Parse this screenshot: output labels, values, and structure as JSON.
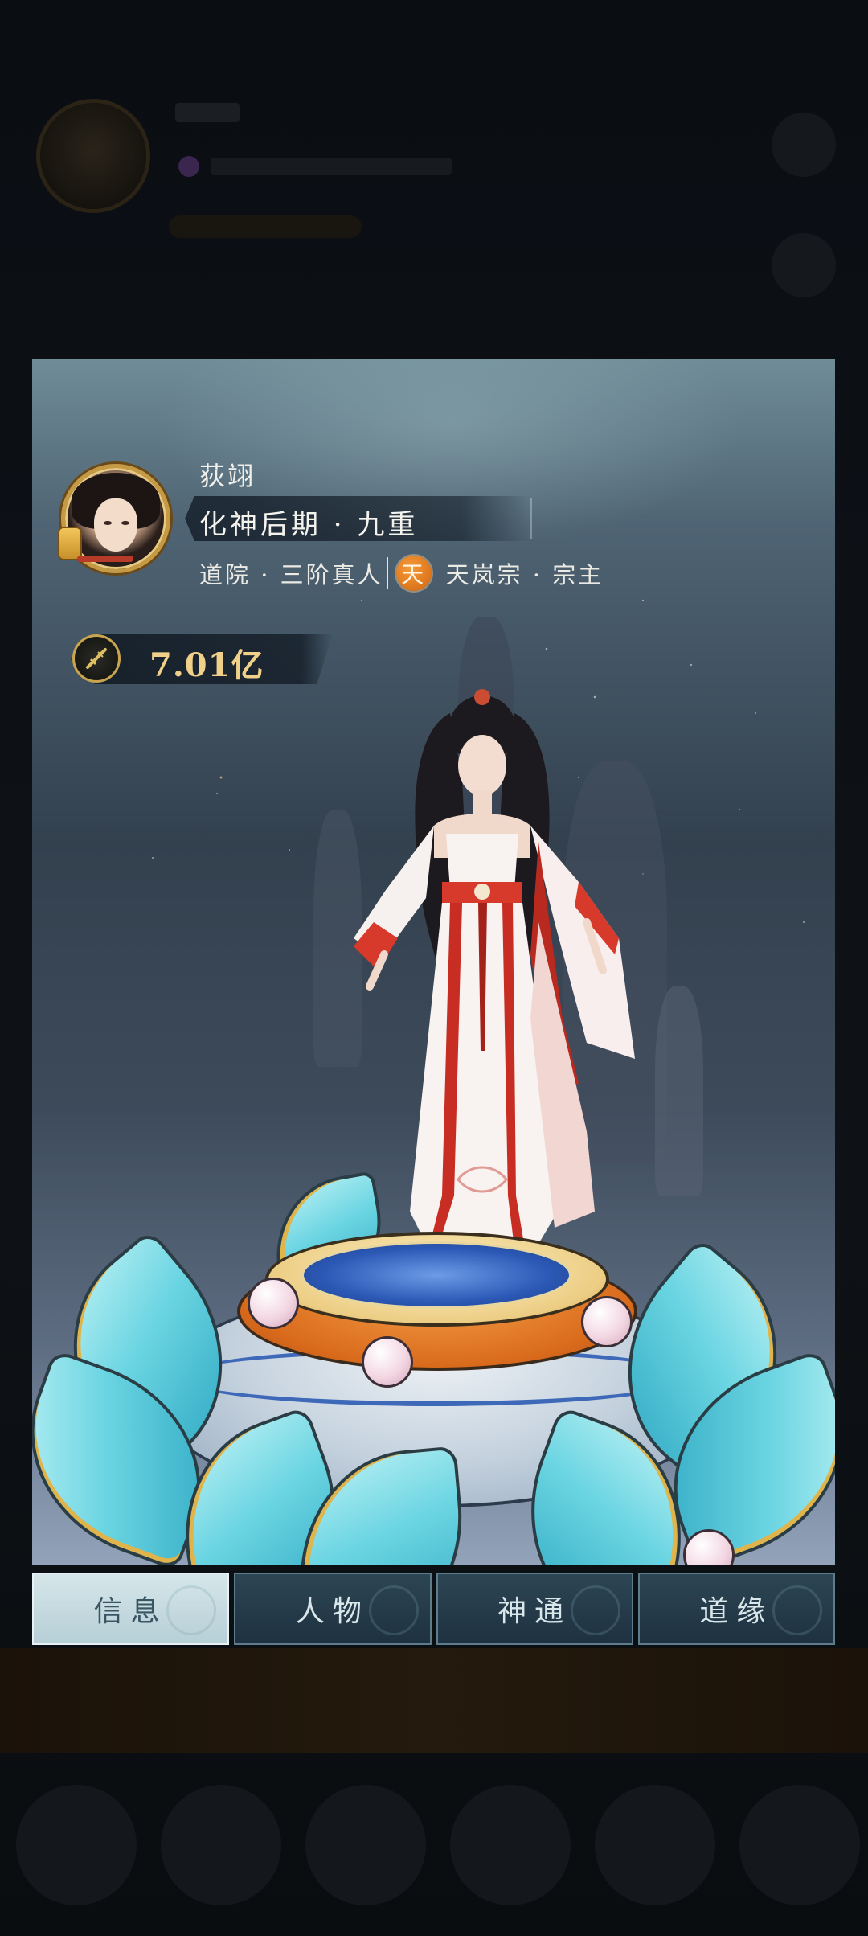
{
  "profile": {
    "name": "荻翊",
    "realm": "化神后期 · 九重",
    "academy_rank": "道院 · 三阶真人",
    "sect_badge": "天",
    "sect_role": "天岚宗 · 宗主",
    "power": "7.01亿"
  },
  "tabs": [
    {
      "label": "信息",
      "active": true
    },
    {
      "label": "人物",
      "active": false
    },
    {
      "label": "神通",
      "active": false
    },
    {
      "label": "道缘",
      "active": false
    }
  ],
  "colors": {
    "power_text": "#f1d089",
    "sect_badge": "#d2650f",
    "active_tab": "#c8dde2"
  },
  "icons": {
    "power": "sword-emblem-icon",
    "portrait": "avatar"
  }
}
